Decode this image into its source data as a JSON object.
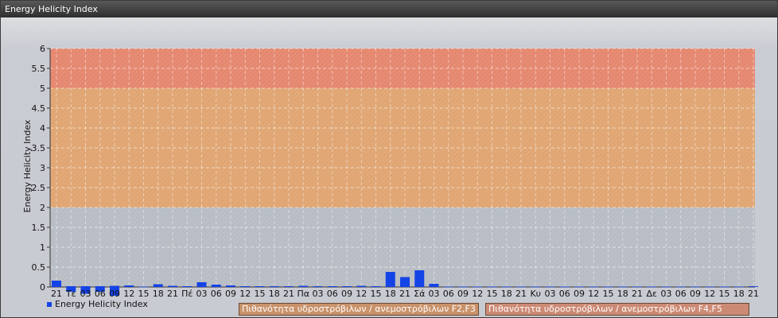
{
  "window": {
    "title": "Energy Helicity Index"
  },
  "chart_data": {
    "type": "bar",
    "ylabel": "Energy Helicity Index",
    "ylim": [
      0,
      6
    ],
    "yticks": [
      0,
      0.5,
      1,
      1.5,
      2,
      2.5,
      3,
      3.5,
      4,
      4.5,
      5,
      5.5,
      6
    ],
    "categories": [
      "21",
      "Τε",
      "03",
      "06",
      "09",
      "12",
      "15",
      "18",
      "21",
      "Πέ",
      "03",
      "06",
      "09",
      "12",
      "15",
      "18",
      "21",
      "Πα",
      "03",
      "06",
      "09",
      "12",
      "15",
      "18",
      "21",
      "Σά",
      "03",
      "06",
      "09",
      "12",
      "15",
      "18",
      "21",
      "Κυ",
      "03",
      "06",
      "09",
      "12",
      "15",
      "18",
      "21",
      "Δε",
      "03",
      "06",
      "09",
      "12",
      "15",
      "18",
      "21"
    ],
    "series": [
      {
        "name": "Energy Helicity Index",
        "color": "#1443e6",
        "values": [
          0.16,
          0.02,
          0.02,
          0.02,
          0.03,
          0.04,
          0.01,
          0.07,
          0.03,
          0.02,
          0.12,
          0.06,
          0.04,
          0.02,
          0.02,
          0.02,
          0.02,
          0.03,
          0.02,
          0.02,
          0.02,
          0.03,
          0.02,
          0.38,
          0.25,
          0.42,
          0.08,
          0.01,
          0.01,
          0.01,
          0.01,
          0.01,
          0.01,
          0.01,
          0.01,
          0.01,
          0.01,
          0.01,
          0.01,
          0.01,
          0.01,
          0.01,
          0.01,
          0.01,
          0.01,
          0.01,
          0.01,
          0.01,
          0.02
        ]
      }
    ],
    "negative_artifacts": [
      0,
      -0.12,
      -0.17,
      -0.12,
      -0.22,
      0,
      0,
      0,
      0,
      0,
      0,
      0,
      0,
      0,
      0,
      0,
      0,
      0,
      0,
      0,
      0,
      0,
      0,
      0,
      0,
      0,
      0,
      0,
      0,
      0,
      0,
      0,
      0,
      0,
      0,
      0,
      0,
      0,
      0,
      0,
      0,
      0,
      0,
      0,
      0,
      0,
      0,
      0,
      0
    ],
    "bands": [
      {
        "from": 0,
        "to": 2,
        "color": "#b8bcc4"
      },
      {
        "from": 2,
        "to": 5,
        "color": "#e0a572"
      },
      {
        "from": 5,
        "to": 6,
        "color": "#e5876f"
      }
    ],
    "grid": true,
    "legend": {
      "series_label": "Energy Helicity Index",
      "band_f2f3": "Πιθανότητα υδροστρόβιλων / ανεμοστρόβιλων F2,F3",
      "band_f4f5": "Πιθανότητα υδροστρόβιλων / ανεμοστρόβιλων F4,F5"
    }
  }
}
